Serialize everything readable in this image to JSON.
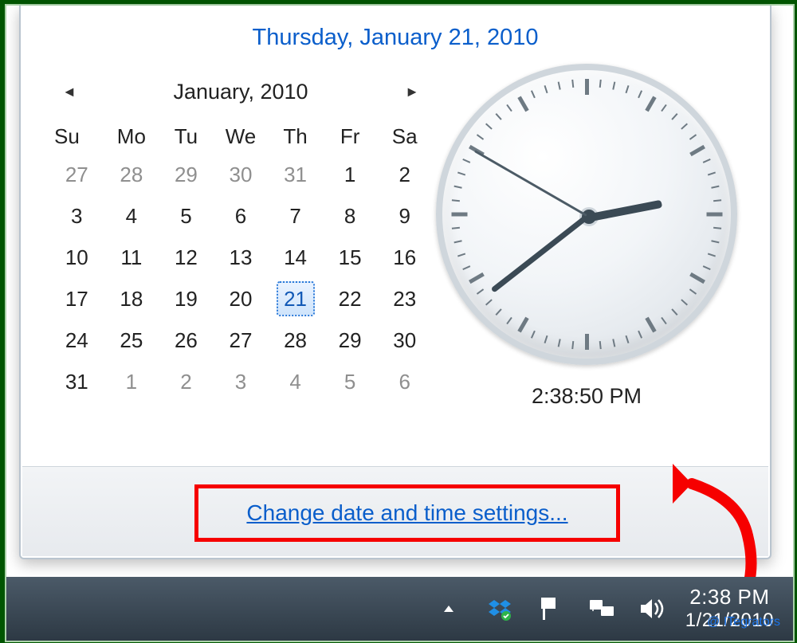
{
  "header": {
    "full_date": "Thursday, January 21, 2010"
  },
  "calendar": {
    "month_label": "January, 2010",
    "dow": [
      "Su",
      "Mo",
      "Tu",
      "We",
      "Th",
      "Fr",
      "Sa"
    ],
    "weeks": [
      [
        {
          "d": 27,
          "o": true
        },
        {
          "d": 28,
          "o": true
        },
        {
          "d": 29,
          "o": true
        },
        {
          "d": 30,
          "o": true
        },
        {
          "d": 31,
          "o": true
        },
        {
          "d": 1
        },
        {
          "d": 2
        }
      ],
      [
        {
          "d": 3
        },
        {
          "d": 4
        },
        {
          "d": 5
        },
        {
          "d": 6
        },
        {
          "d": 7
        },
        {
          "d": 8
        },
        {
          "d": 9
        }
      ],
      [
        {
          "d": 10
        },
        {
          "d": 11
        },
        {
          "d": 12
        },
        {
          "d": 13
        },
        {
          "d": 14
        },
        {
          "d": 15
        },
        {
          "d": 16
        }
      ],
      [
        {
          "d": 17
        },
        {
          "d": 18
        },
        {
          "d": 19
        },
        {
          "d": 20
        },
        {
          "d": 21,
          "sel": true
        },
        {
          "d": 22
        },
        {
          "d": 23
        }
      ],
      [
        {
          "d": 24
        },
        {
          "d": 25
        },
        {
          "d": 26
        },
        {
          "d": 27
        },
        {
          "d": 28
        },
        {
          "d": 29
        },
        {
          "d": 30
        }
      ],
      [
        {
          "d": 31
        },
        {
          "d": 1,
          "o": true
        },
        {
          "d": 2,
          "o": true
        },
        {
          "d": 3,
          "o": true
        },
        {
          "d": 4,
          "o": true
        },
        {
          "d": 5,
          "o": true
        },
        {
          "d": 6,
          "o": true
        }
      ]
    ]
  },
  "clock": {
    "digital": "2:38:50 PM",
    "hour_angle": 79,
    "minute_angle": 232,
    "second_angle": 300
  },
  "footer": {
    "link_text": "Change date and time settings..."
  },
  "taskbar": {
    "time": "2:38 PM",
    "date": "1/21/2010",
    "tray_icons": [
      "show-hidden-icons",
      "dropbox-icon",
      "action-center-icon",
      "network-icon",
      "volume-icon"
    ]
  },
  "watermark": "@ ITegrators"
}
